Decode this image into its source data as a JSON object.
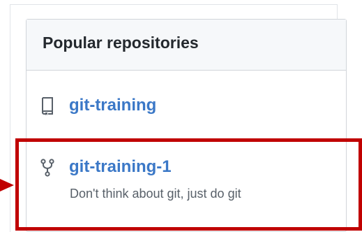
{
  "popular_repos": {
    "title": "Popular repositories",
    "items": [
      {
        "name": "git-training",
        "icon": "repo-icon",
        "description": ""
      },
      {
        "name": "git-training-1",
        "icon": "repo-forked-icon",
        "description": "Don't think about git, just do git"
      }
    ]
  },
  "annotation": {
    "color": "#c00000"
  }
}
